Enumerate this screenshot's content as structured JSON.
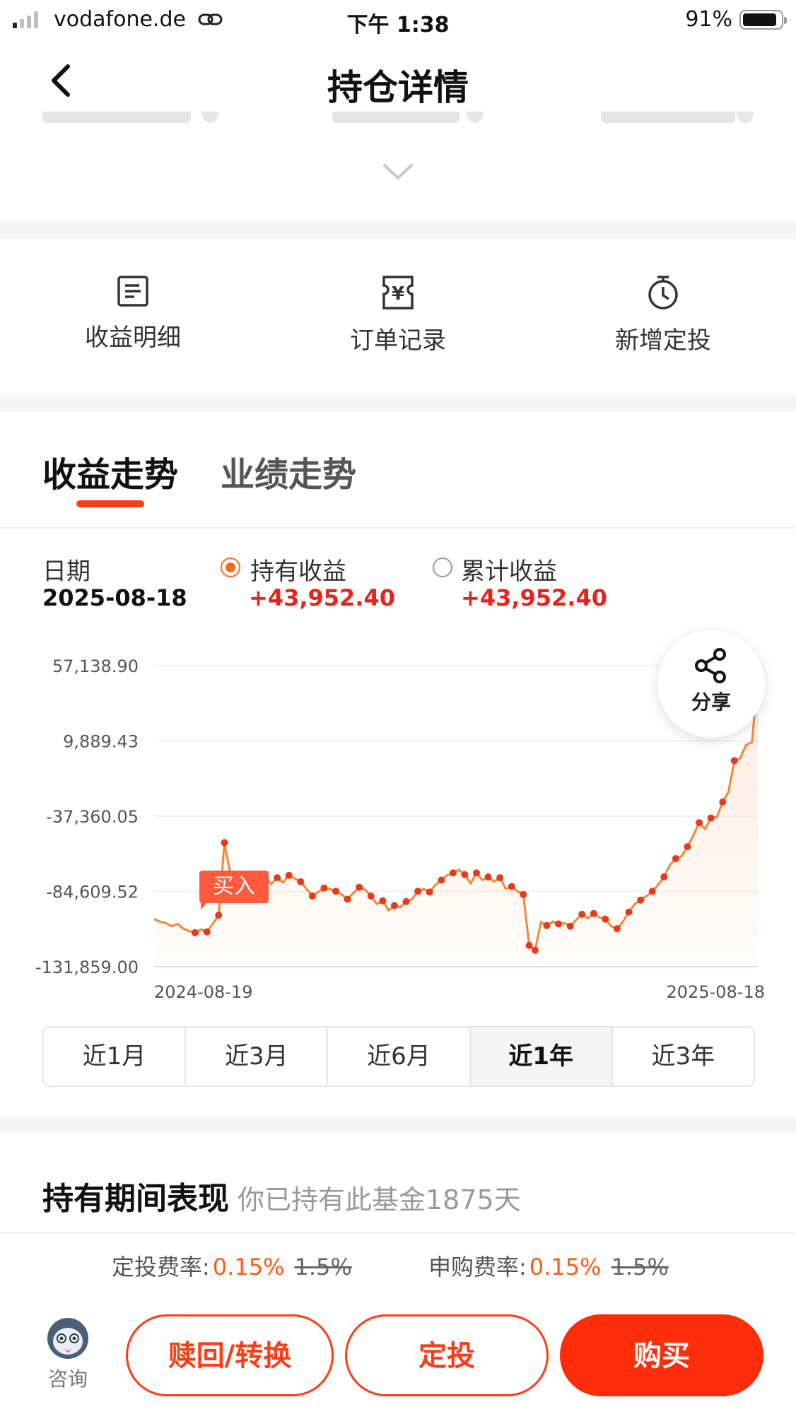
{
  "status_bar": {
    "carrier": "vodafone.de",
    "time": "下午 1:38",
    "battery": "91%"
  },
  "nav": {
    "title": "持仓详情",
    "back_icon": "chevron-left-icon"
  },
  "quick_actions": [
    {
      "label": "收益明细",
      "icon": "list-doc-icon"
    },
    {
      "label": "订单记录",
      "icon": "yen-receipt-icon"
    },
    {
      "label": "新增定投",
      "icon": "stopwatch-icon"
    }
  ],
  "tabs": {
    "active": "收益走势",
    "inactive": "业绩走势"
  },
  "legend": {
    "date_label": "日期",
    "date_value": "2025-08-18",
    "holding_label": "持有收益",
    "holding_value": "+43,952.40",
    "cumulative_label": "累计收益",
    "cumulative_value": "+43,952.40"
  },
  "share": {
    "label": "分享",
    "icon": "share-icon"
  },
  "buy_marker": "买入",
  "periods": [
    {
      "label": "近1月",
      "active": false
    },
    {
      "label": "近3月",
      "active": false
    },
    {
      "label": "近6月",
      "active": false
    },
    {
      "label": "近1年",
      "active": true
    },
    {
      "label": "近3年",
      "active": false
    }
  ],
  "performance": {
    "title": "持有期间表现",
    "subtitle": "你已持有此基金1875天"
  },
  "fees": {
    "sip_label": "定投费率:",
    "sip_rate": "0.15%",
    "sip_original": "1.5%",
    "purchase_label": "申购费率:",
    "purchase_rate": "0.15%",
    "purchase_original": "1.5%"
  },
  "bottom_bar": {
    "consult_label": "咨询",
    "redeem_label": "赎回/转换",
    "sip_label": "定投",
    "buy_label": "购买"
  },
  "colors": {
    "accent": "#ff3c16",
    "line": "#f0883a",
    "dot": "#e8391a",
    "gain": "#e8221c"
  },
  "chart_data": {
    "type": "line",
    "x_labels": [
      "2024-08-19",
      "2025-08-18"
    ],
    "y_ticks": [
      "57,138.90",
      "9,889.43",
      "-37,360.05",
      "-84,609.52",
      "-131,859.00"
    ],
    "ylim": [
      -131859.0,
      57138.9
    ],
    "grid": true,
    "series": [
      {
        "values": [
          -102000,
          -103500,
          -104500,
          -106500,
          -105000,
          -108000,
          -109500,
          -110500,
          -108500,
          -110000,
          -105000,
          -99500,
          -54000,
          -73500,
          -79500,
          -78500,
          -81500,
          -77000,
          -79500,
          -76000,
          -80000,
          -76000,
          -79000,
          -74500,
          -76500,
          -78500,
          -83000,
          -87500,
          -85000,
          -82500,
          -83000,
          -84500,
          -86500,
          -89500,
          -85500,
          -82000,
          -83500,
          -87500,
          -92500,
          -90500,
          -96500,
          -93500,
          -94500,
          -91000,
          -89500,
          -84500,
          -83000,
          -85000,
          -80500,
          -77500,
          -74500,
          -73000,
          -71000,
          -74000,
          -79500,
          -73000,
          -77500,
          -75500,
          -78500,
          -76000,
          -83000,
          -81500,
          -84500,
          -86500,
          -118500,
          -121500,
          -104000,
          -106000,
          -103500,
          -105000,
          -104500,
          -106500,
          -102500,
          -99000,
          -101500,
          -98500,
          -101000,
          -102000,
          -106500,
          -108000,
          -103500,
          -97500,
          -92500,
          -90000,
          -87500,
          -84500,
          -80500,
          -75500,
          -68000,
          -64000,
          -62500,
          -56500,
          -49500,
          -41500,
          -45500,
          -38500,
          -38000,
          -28500,
          -22000,
          -2500,
          -1000,
          7500,
          9000,
          50000
        ]
      }
    ]
  }
}
